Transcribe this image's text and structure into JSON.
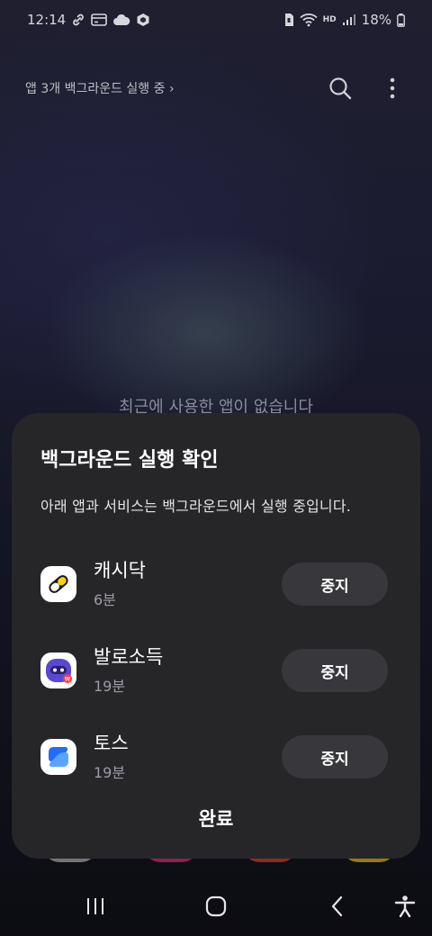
{
  "status_bar": {
    "time": "12:14",
    "battery": "18%",
    "network_label": "HD"
  },
  "recents": {
    "bg_apps_link": "앱 3개 백그라운드 실행 중 ›",
    "empty_message": "최근에 사용한 앱이 없습니다"
  },
  "sheet": {
    "title": "백그라운드 실행 확인",
    "description": "아래 앱과 서비스는 백그라운드에서 실행 중입니다.",
    "apps": [
      {
        "name": "캐시닥",
        "time": "6분",
        "stop_label": "중지",
        "icon": "cashdoc-pill-icon"
      },
      {
        "name": "발로소득",
        "time": "19분",
        "stop_label": "중지",
        "icon": "ballo-robot-icon"
      },
      {
        "name": "토스",
        "time": "19분",
        "stop_label": "중지",
        "icon": "toss-icon"
      }
    ],
    "done_label": "완료"
  },
  "colors": {
    "sheet_bg": "#262629",
    "button_bg": "#38383c",
    "toss_blue": "#1e6dfd",
    "cashdoc_yellow": "#ffd400",
    "ballo_purple": "#5a47d6"
  }
}
